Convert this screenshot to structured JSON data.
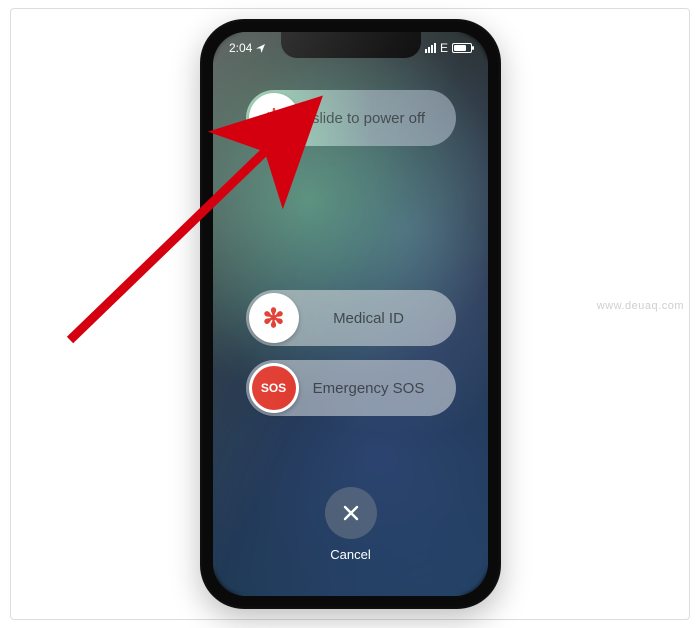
{
  "status": {
    "time": "2:04",
    "carrier": "E"
  },
  "power_slider": {
    "label": "slide to power off",
    "icon_color": "#e03a2f"
  },
  "medical_slider": {
    "label": "Medical ID",
    "icon_glyph": "✻",
    "icon_color": "#e03a2f"
  },
  "sos_slider": {
    "label": "Emergency SOS",
    "icon_text": "SOS",
    "icon_bg": "#e03a2f"
  },
  "cancel": {
    "label": "Cancel"
  },
  "watermark": "www.deuaq.com"
}
